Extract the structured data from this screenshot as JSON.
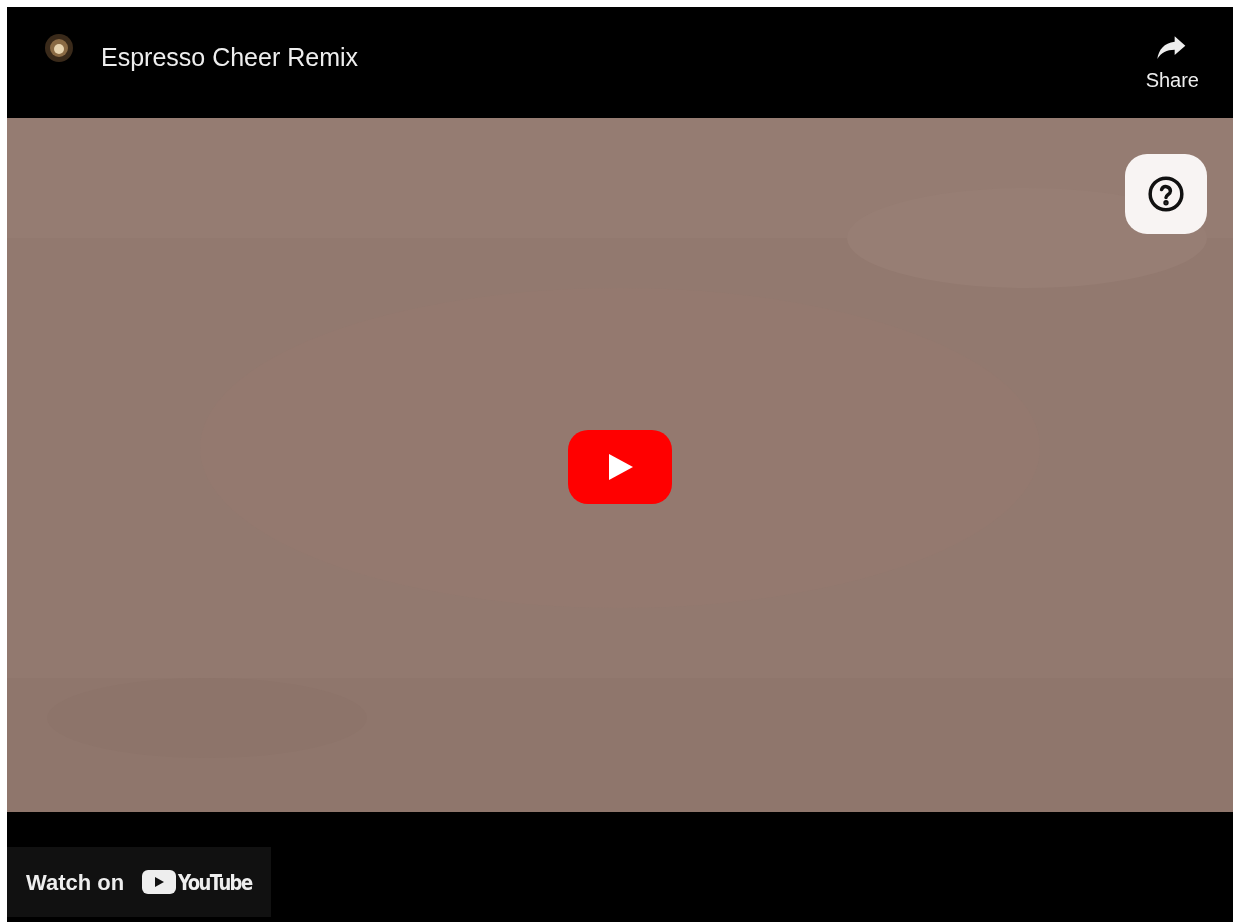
{
  "video": {
    "title": "Espresso Cheer Remix",
    "share_label": "Share"
  },
  "watch_on": {
    "label": "Watch on",
    "brand": "YouTube"
  }
}
